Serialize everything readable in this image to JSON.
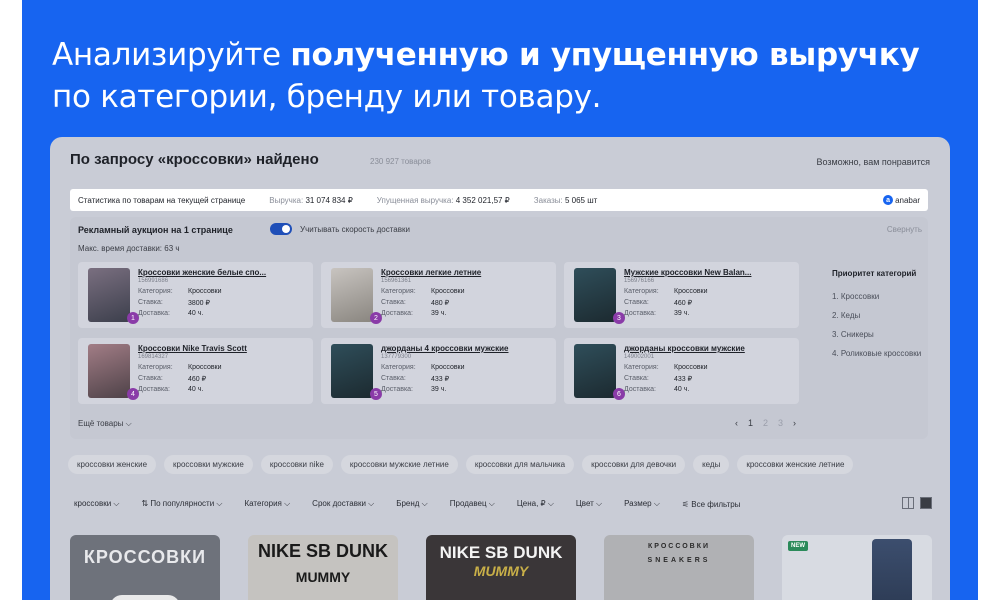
{
  "headline": {
    "line1_plain": "Анализируйте ",
    "line1_bold": "полученную и упущенную выручку",
    "line2": "по категории, бренду или товару."
  },
  "search": {
    "title": "По запросу «кроссовки» найдено",
    "count": "230 927 товаров",
    "maybe_like": "Возможно, вам понравится"
  },
  "stats": {
    "label": "Статистика по товарам на текущей странице",
    "revenue_label": "Выручка:",
    "revenue_value": "31 074 834 ₽",
    "lost_label": "Упущенная выручка:",
    "lost_value": "4 352 021,57 ₽",
    "orders_label": "Заказы:",
    "orders_value": "5 065 шт",
    "brand": "anabar"
  },
  "auction": {
    "title": "Рекламный аукцион на 1 странице",
    "toggle_label": "Учитывать скорость доставки",
    "collapse": "Свернуть",
    "delivery_time": "Макс. время доставки: 63 ч",
    "category_label": "Категория:",
    "bid_label": "Ставка:",
    "delivery_label": "Доставка:",
    "more": "Ещё товары",
    "pager": [
      "‹",
      "1",
      "2",
      "3",
      "›"
    ],
    "cards": [
      {
        "name": "Кроссовки женские белые спо...",
        "sku": "156991686",
        "category": "Кроссовки",
        "bid": "3800 ₽",
        "delivery": "40 ч.",
        "badge": "1"
      },
      {
        "name": "Кроссовки легкие летние",
        "sku": "156961361",
        "category": "Кроссовки",
        "bid": "480 ₽",
        "delivery": "39 ч.",
        "badge": "2"
      },
      {
        "name": "Мужские кроссовки New Balan...",
        "sku": "156976166",
        "category": "Кроссовки",
        "bid": "460 ₽",
        "delivery": "39 ч.",
        "badge": "3"
      },
      {
        "name": "Кроссовки Nike Travis Scott",
        "sku": "169814327",
        "category": "Кроссовки",
        "bid": "460 ₽",
        "delivery": "40 ч.",
        "badge": "4"
      },
      {
        "name": "джорданы 4 кроссовки мужские",
        "sku": "137779300",
        "category": "Кроссовки",
        "bid": "433 ₽",
        "delivery": "39 ч.",
        "badge": "5"
      },
      {
        "name": "джорданы кроссовки мужские",
        "sku": "149002001",
        "category": "Кроссовки",
        "bid": "433 ₽",
        "delivery": "40 ч.",
        "badge": "6"
      }
    ]
  },
  "priority": {
    "title": "Приоритет категорий",
    "items": [
      "1. Кроссовки",
      "2. Кеды",
      "3. Сникеры",
      "4. Роликовые кроссовки"
    ]
  },
  "chips": [
    "кроссовки женские",
    "кроссовки мужские",
    "кроссовки nike",
    "кроссовки мужские летние",
    "кроссовки для мальчика",
    "кроссовки для девочки",
    "кеды",
    "кроссовки женские летние"
  ],
  "filters": [
    "кроссовки ⌵",
    "⇅ По популярности ⌵",
    "Категория ⌵",
    "Срок доставки ⌵",
    "Бренд ⌵",
    "Продавец ⌵",
    "Цена, ₽ ⌵",
    "Цвет ⌵",
    "Размер ⌵",
    "⚟ Все фильтры"
  ],
  "tiles": [
    {
      "text": "КРОССОВКИ",
      "sub": ""
    },
    {
      "text": "NIKE SB DUNK",
      "sub": "MUMMY"
    },
    {
      "text": "NIKE SB DUNK",
      "sub": "MUMMY"
    },
    {
      "text": "КРОССОВКИ",
      "sub": "SNEAKERS"
    },
    {
      "text": "",
      "sub": "",
      "badge": "NEW"
    }
  ]
}
